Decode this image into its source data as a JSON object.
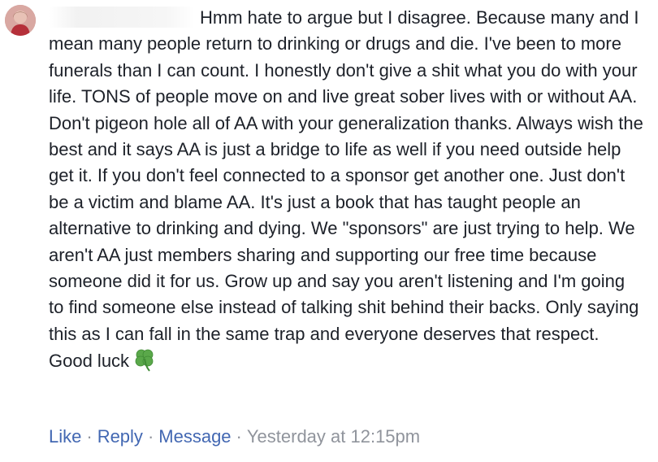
{
  "comment": {
    "author_name": "",
    "text": "Hmm hate to argue but I disagree. Because many and I mean many people return to drinking or drugs and die. I've been to more funerals than I can count. I honestly don't give a shit what you do with your life. TONS of people move on and live great sober lives with or without AA. Don't pigeon hole all of AA with your generalization thanks. Always wish the best and it says AA is just a bridge to life as well if you need outside help get it. If you don't feel connected to a sponsor get another one. Just don't be a victim and blame AA. It's just a book that has taught people an alternative to drinking and dying. We \"sponsors\" are just trying to help. We aren't AA just members sharing and supporting our free time because someone did it for us. Grow up and say you aren't listening and I'm going to find someone else instead of talking shit behind their backs. Only saying this as I can fall in the same trap and everyone deserves that respect. Good luck",
    "emoji_icon": "four-leaf-clover-icon"
  },
  "actions": {
    "like_label": "Like",
    "reply_label": "Reply",
    "message_label": "Message",
    "separator": "·",
    "timestamp": "Yesterday at 12:15pm"
  },
  "colors": {
    "text": "#1d2129",
    "link": "#4267b2",
    "meta": "#90949c"
  }
}
